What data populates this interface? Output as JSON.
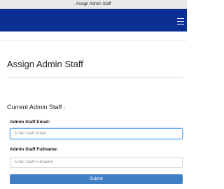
{
  "window": {
    "title": "Assign Admin Staff"
  },
  "navbar": {
    "menu_icon": "hamburger-menu-icon",
    "background_color": "#0b2f93"
  },
  "page": {
    "title": "Assign Admin Staff",
    "section_title": "Current Admin Staff :"
  },
  "form": {
    "email": {
      "label": "Admin Staff Email:",
      "placeholder": "Enter Staff Email",
      "value": ""
    },
    "fullname": {
      "label": "Admin Staff Fullname:",
      "placeholder": "Enter Staff Fullname",
      "value": ""
    },
    "submit_label": "Submit",
    "submit_color": "#3f7fc3"
  }
}
